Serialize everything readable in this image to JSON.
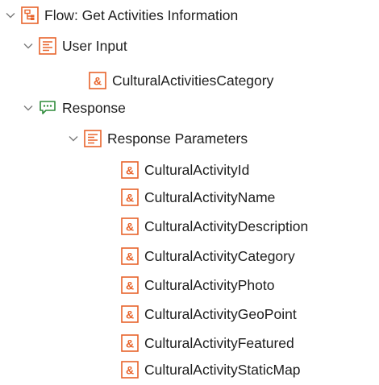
{
  "tree": {
    "flow": {
      "label": "Flow: Get Activities Information",
      "icon": "flow-icon",
      "expanded": true
    },
    "user_input": {
      "label": "User Input",
      "icon": "parameters-icon",
      "expanded": true,
      "children": [
        "CulturalActivitiesCategory"
      ]
    },
    "response": {
      "label": "Response",
      "icon": "response-speech-bubble-icon",
      "expanded": true
    },
    "response_parameters": {
      "label": "Response Parameters",
      "icon": "parameters-icon",
      "expanded": true,
      "children": [
        "CulturalActivityId",
        "CulturalActivityName",
        "CulturalActivityDescription",
        "CulturalActivityCategory",
        "CulturalActivityPhoto",
        "CulturalActivityGeoPoint",
        "CulturalActivityFeatured",
        "CulturalActivityStaticMap"
      ]
    }
  },
  "colors": {
    "accent_orange": "#e8632b",
    "response_green": "#2e8b3a",
    "chevron_gray": "#7a7a7a",
    "text": "#1e1e1e"
  }
}
